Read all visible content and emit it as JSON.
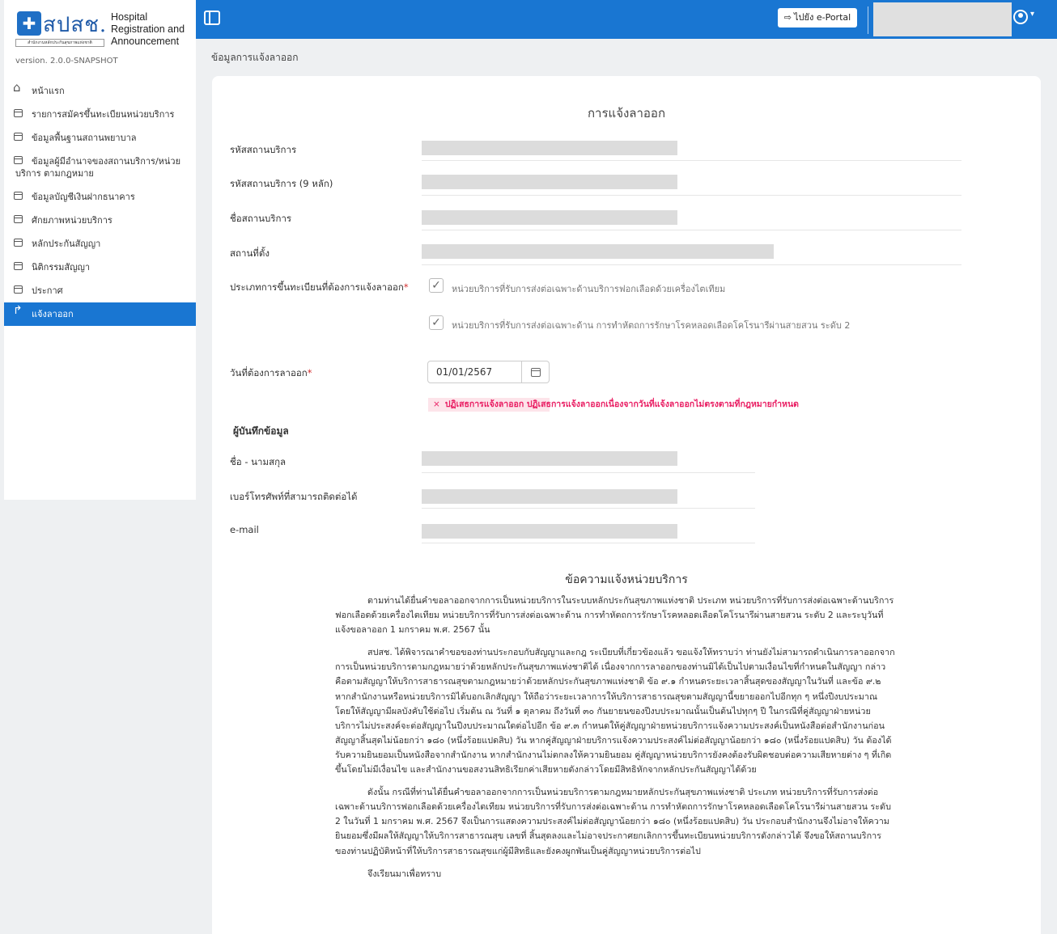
{
  "app": {
    "logo_text": "สปสช.",
    "logo_subtitle": "สำนักงานหลักประกันสุขภาพแห่งชาติ",
    "name_line1": "Hospital",
    "name_line2": "Registration and",
    "name_line3": "Announcement",
    "version": "version. 2.0.0-SNAPSHOT"
  },
  "sidebar": {
    "items": [
      {
        "label": "หน้าแรก",
        "icon": "home-icon"
      },
      {
        "label": "รายการสมัครขึ้นทะเบียนหน่วยบริการ",
        "icon": "list-icon"
      },
      {
        "label": "ข้อมูลพื้นฐานสถานพยาบาล",
        "icon": "list-icon"
      },
      {
        "label": "ข้อมูลผู้มีอำนาจของสถานบริการ/หน่วยบริการ ตามกฎหมาย",
        "icon": "list-icon"
      },
      {
        "label": "ข้อมูลบัญชีเงินฝากธนาคาร",
        "icon": "list-icon"
      },
      {
        "label": "ศักยภาพหน่วยบริการ",
        "icon": "list-icon"
      },
      {
        "label": "หลักประกันสัญญา",
        "icon": "list-icon"
      },
      {
        "label": "นิติกรรมสัญญา",
        "icon": "list-icon"
      },
      {
        "label": "ประกาศ",
        "icon": "list-icon"
      },
      {
        "label": "แจ้งลาออก",
        "icon": "exit-arrow-icon",
        "active": true
      }
    ]
  },
  "topbar": {
    "portal_label": "ไปยัง e-Portal"
  },
  "breadcrumb": "ข้อมูลการแจ้งลาออก",
  "form": {
    "title": "การแจ้งลาออก",
    "fields": {
      "code_label": "รหัสสถานบริการ",
      "code9_label": "รหัสสถานบริการ (9 หลัก)",
      "name_label": "ชื่อสถานบริการ",
      "location_label": "สถานที่ตั้ง",
      "type_label": "ประเภทการขึ้นทะเบียนที่ต้องการแจ้งลาออก",
      "date_label": "วันที่ต้องการลาออก"
    },
    "required_mark": "*",
    "checkbox_1": "หน่วยบริการที่รับการส่งต่อเฉพาะด้านบริการฟอกเลือดด้วยเครื่องไตเทียม",
    "checkbox_2": "หน่วยบริการที่รับการส่งต่อเฉพาะด้าน การทำหัตถการรักษาโรคหลอดเลือดโคโรนารีผ่านสายสวน ระดับ 2",
    "checkbox_1_checked": true,
    "checkbox_2_checked": true,
    "date_value": "01/01/2567",
    "error_message": "ปฏิเสธการแจ้งลาออก ปฏิเสธการแจ้งลาออกเนื่องจากวันที่แจ้งลาออกไม่ตรงตามที่กฎหมายกำหนด",
    "recorder_heading": "ผู้บันทึกข้อมูล",
    "recorder_name_label": "ชื่อ - นามสกุล",
    "recorder_phone_label": "เบอร์โทรศัพท์ที่สามารถติดต่อได้",
    "recorder_email_label": "e-mail"
  },
  "notice": {
    "title": "ข้อความแจ้งหน่วยบริการ",
    "p1": "ตามท่านได้ยื่นคำขอลาออกจากการเป็นหน่วยบริการในระบบหลักประกันสุขภาพแห่งชาติ ประเภท หน่วยบริการที่รับการส่งต่อเฉพาะด้านบริการฟอกเลือดด้วยเครื่องไตเทียม หน่วยบริการที่รับการส่งต่อเฉพาะด้าน การทำหัตถการรักษาโรคหลอดเลือดโคโรนารีผ่านสายสวน ระดับ 2 และระบุวันที่แจ้งขอลาออก 1 มกราคม พ.ศ. 2567 นั้น",
    "p2": "สปสช. ได้พิจารณาคำขอของท่านประกอบกับสัญญาและกฎ ระเบียบที่เกี่ยวข้องแล้ว ขอแจ้งให้ทราบว่า ท่านยังไม่สามารถดำเนินการลาออกจากการเป็นหน่วยบริการตามกฎหมายว่าด้วยหลักประกันสุขภาพแห่งชาติได้ เนื่องจากการลาออกของท่านมิได้เป็นไปตามเงื่อนไขที่กำหนดในสัญญา กล่าวคือตามสัญญาให้บริการสาธารณสุขตามกฎหมายว่าด้วยหลักประกันสุขภาพแห่งชาติ ข้อ ๙.๑ กำหนดระยะเวลาสิ้นสุดของสัญญาในวันที่ และข้อ ๙.๒ หากสำนักงานหรือหน่วยบริการมิได้บอกเลิกสัญญา ให้ถือว่าระยะเวลาการให้บริการสาธารณสุขตามสัญญานี้ขยายออกไปอีกทุก ๆ หนึ่งปีงบประมาณ โดยให้สัญญามีผลบังคับใช้ต่อไป เริ่มต้น ณ วันที่ ๑ ตุลาคม ถึงวันที่ ๓๐ กันยายนของปีงบประมาณนั้นเป็นต้นไปทุกๆ ปี ในกรณีที่คู่สัญญาฝ่ายหน่วยบริการไม่ประสงค์จะต่อสัญญาในปีงบประมาณใดต่อไปอีก ข้อ ๙.๓ กำหนดให้คู่สัญญาฝ่ายหน่วยบริการแจ้งความประสงค์เป็นหนังสือต่อสำนักงานก่อนสัญญาสิ้นสุดไม่น้อยกว่า ๑๘๐ (หนึ่งร้อยแปดสิบ) วัน หากคู่สัญญาฝ่ายบริการแจ้งความประสงค์ไม่ต่อสัญญาน้อยกว่า ๑๘๐ (หนึ่งร้อยแปดสิบ) วัน ต้องได้รับความยินยอมเป็นหนังสือจากสำนักงาน หากสำนักงานไม่ตกลงให้ความยินยอม คู่สัญญาหน่วยบริการยังคงต้องรับผิดชอบต่อความเสียหายต่าง ๆ ที่เกิดขึ้นโดยไม่มีเงื่อนไข และสำนักงานขอสงวนสิทธิเรียกค่าเสียหายดังกล่าวโดยมีสิทธิหักจากหลักประกันสัญญาได้ด้วย",
    "p3": "ดังนั้น กรณีที่ท่านได้ยื่นคำขอลาออกจากการเป็นหน่วยบริการตามกฎหมายหลักประกันสุขภาพแห่งชาติ ประเภท หน่วยบริการที่รับการส่งต่อเฉพาะด้านบริการฟอกเลือดด้วยเครื่องไตเทียม หน่วยบริการที่รับการส่งต่อเฉพาะด้าน การทำหัตถการรักษาโรคหลอดเลือดโคโรนารีผ่านสายสวน ระดับ 2 ในวันที่ 1 มกราคม พ.ศ. 2567 จึงเป็นการแสดงความประสงค์ไม่ต่อสัญญาน้อยกว่า ๑๘๐ (หนึ่งร้อยแปดสิบ) วัน ประกอบสำนักงานจึงไม่อาจให้ความยินยอมซึ่งมีผลให้สัญญาให้บริการสาธารณสุข เลขที่ สิ้นสุดลงและไม่อาจประกาศยกเลิกการขึ้นทะเบียนหน่วยบริการดังกล่าวได้ จึงขอให้สถานบริการของท่านปฏิบัติหน้าที่ให้บริการสาธารณสุขแก่ผู้มีสิทธิและยังคงผูกพันเป็นคู่สัญญาหน่วยบริการต่อไป",
    "p4": "จึงเรียนมาเพื่อทราบ"
  },
  "colors": {
    "primary": "#1976d2",
    "error": "#e91e63",
    "error_bg": "#fde4ea",
    "redacted": "#dcdcdc"
  }
}
